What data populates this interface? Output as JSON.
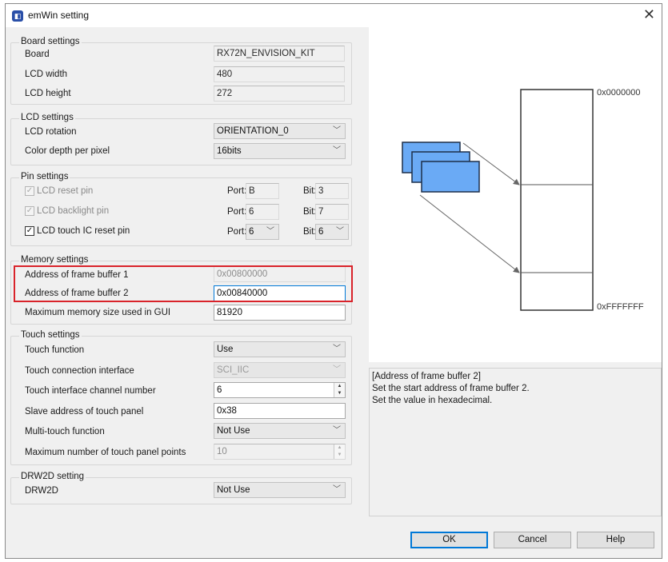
{
  "window": {
    "title": "emWin setting",
    "close_symbol": "✕"
  },
  "board_settings": {
    "title": "Board settings",
    "board": {
      "label": "Board",
      "value": "RX72N_ENVISION_KIT"
    },
    "lcd_width": {
      "label": "LCD width",
      "value": "480"
    },
    "lcd_height": {
      "label": "LCD height",
      "value": "272"
    }
  },
  "lcd_settings": {
    "title": "LCD settings",
    "rotation": {
      "label": "LCD rotation",
      "value": "ORIENTATION_0"
    },
    "color_depth": {
      "label": "Color depth per pixel",
      "value": "16bits"
    }
  },
  "pin_settings": {
    "title": "Pin settings",
    "port_label": "Port:",
    "bit_label": "Bit:",
    "rows": [
      {
        "label": "LCD reset pin",
        "checked": true,
        "enabled": false,
        "port": "B",
        "bit": "3"
      },
      {
        "label": "LCD backlight pin",
        "checked": true,
        "enabled": false,
        "port": "6",
        "bit": "7"
      },
      {
        "label": "LCD touch IC reset pin",
        "checked": true,
        "enabled": true,
        "port": "6",
        "bit": "6"
      }
    ]
  },
  "memory_settings": {
    "title": "Memory settings",
    "fb1": {
      "label": "Address of frame buffer 1",
      "value": "0x00800000"
    },
    "fb2": {
      "label": "Address of frame buffer 2",
      "value": "0x00840000"
    },
    "max_mem": {
      "label": "Maximum memory size used in GUI",
      "value": "81920"
    }
  },
  "touch_settings": {
    "title": "Touch settings",
    "touch_function": {
      "label": "Touch function",
      "value": "Use"
    },
    "connection": {
      "label": "Touch connection interface",
      "value": "SCI_IIC"
    },
    "channel": {
      "label": "Touch interface channel number",
      "value": "6"
    },
    "slave_addr": {
      "label": "Slave address of touch panel",
      "value": "0x38"
    },
    "multi_touch": {
      "label": "Multi-touch function",
      "value": "Not Use"
    },
    "max_points": {
      "label": "Maximum number of touch panel points",
      "value": "10"
    }
  },
  "drw2d_setting": {
    "title": "DRW2D setting",
    "drw2d": {
      "label": "DRW2D",
      "value": "Not Use"
    }
  },
  "diagram": {
    "addr_top": "0x0000000",
    "addr_bottom": "0xFFFFFFF",
    "box_color": "#6aaaf5"
  },
  "description": {
    "line1": "[Address of frame buffer 2]",
    "line2": "Set the start address of frame buffer 2.",
    "line3": "Set the value in hexadecimal."
  },
  "buttons": {
    "ok": "OK",
    "cancel": "Cancel",
    "help": "Help"
  },
  "icons": {
    "dropdown": "chevron-down-icon",
    "check": "checkmark-icon",
    "spin_up": "spin-up-icon",
    "spin_down": "spin-down-icon"
  }
}
